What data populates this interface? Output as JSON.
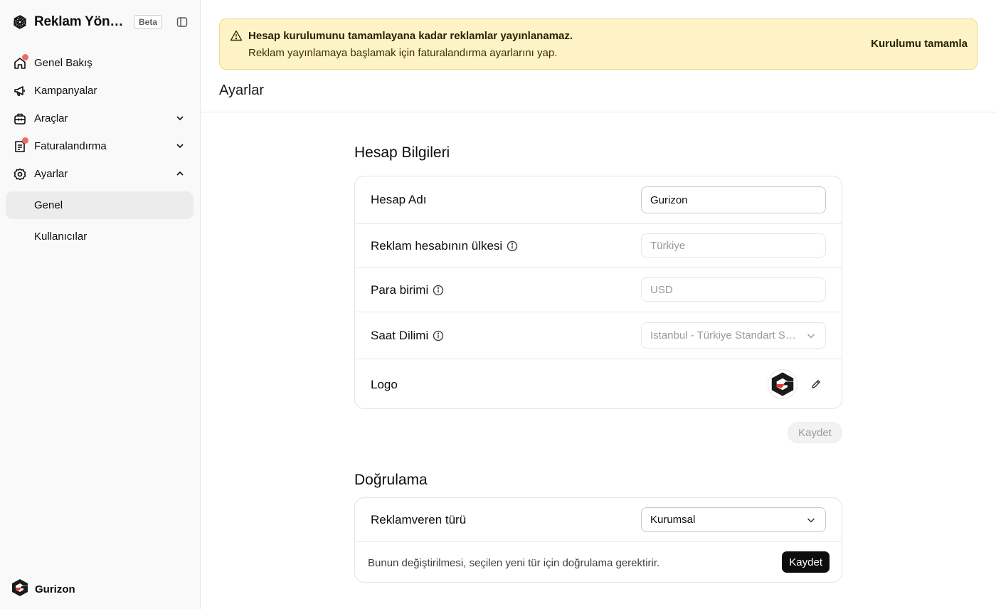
{
  "app": {
    "title": "Reklam Yöneticisi",
    "badge": "Beta"
  },
  "sidebar": {
    "items": [
      {
        "label": "Genel Bakış",
        "icon": "home-icon",
        "notify": true
      },
      {
        "label": "Kampanyalar",
        "icon": "megaphone-icon"
      },
      {
        "label": "Araçlar",
        "icon": "toolbox-icon",
        "expanded": false
      },
      {
        "label": "Faturalandırma",
        "icon": "receipt-icon",
        "notify": true,
        "expanded": false
      },
      {
        "label": "Ayarlar",
        "icon": "gear-icon",
        "expanded": true
      }
    ],
    "subitems": [
      {
        "label": "Genel",
        "active": true
      },
      {
        "label": "Kullanıcılar",
        "active": false
      }
    ],
    "account": {
      "name": "Gurizon"
    }
  },
  "banner": {
    "title": "Hesap kurulumunu tamamlayana kadar reklamlar yayınlanamaz.",
    "text": "Reklam yayınlamaya başlamak için faturalandırma ayarlarını yap.",
    "action": "Kurulumu tamamla"
  },
  "page": {
    "title": "Ayarlar"
  },
  "account_info": {
    "title": "Hesap Bilgileri",
    "name": {
      "label": "Hesap Adı",
      "value": "Gurizon"
    },
    "country": {
      "label": "Reklam hesabının ülkesi",
      "value": "Türkiye"
    },
    "currency": {
      "label": "Para birimi",
      "value": "USD"
    },
    "timezone": {
      "label": "Saat Dilimi",
      "value": "Istanbul - Türkiye Standart Saati"
    },
    "logo": {
      "label": "Logo"
    },
    "save": "Kaydet"
  },
  "verification": {
    "title": "Doğrulama",
    "type": {
      "label": "Reklamveren türü",
      "value": "Kurumsal"
    },
    "note": "Bunun değiştirilmesi, seçilen yeni tür için doğrulama gerektirir.",
    "save": "Kaydet"
  },
  "colors": {
    "notify_dot": "#ea6f62",
    "banner_bg": "#fdf3c6",
    "banner_border": "#f1d989",
    "logo_red": "#e0352b"
  }
}
